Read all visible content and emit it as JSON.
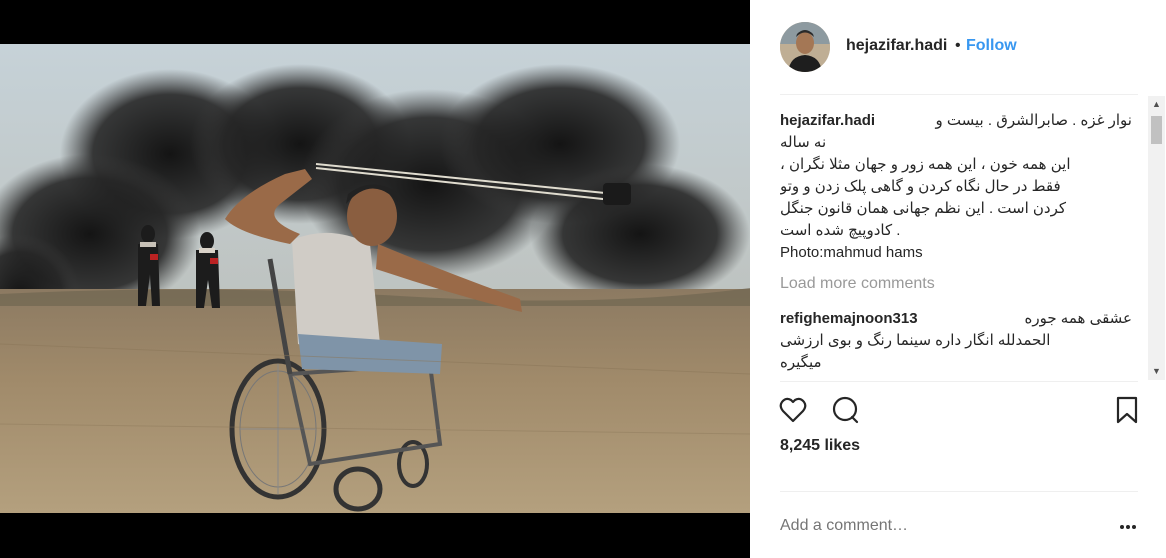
{
  "post": {
    "author": "hejazifar.hadi",
    "follow_label": "Follow",
    "dot": "•",
    "caption_author": "hejazifar.hadi",
    "caption_lines": [
      "نوار غزه . صابرالشرق . بیست و",
      "نه ساله",
      "این همه خون ، این همه زور و جهان مثلا نگران ،",
      "فقط در حال نگاه کردن و گاهی پلک زدن و وتو",
      "کردن است . این نظم جهانی همان قانون جنگل",
      ". کادوپیچ شده است",
      "Photo:mahmud hams"
    ],
    "load_more": "Load more comments",
    "comment": {
      "user": "refighemajnoon313",
      "lines": [
        "عشقی همه جوره",
        "الحمدلله انگار داره سینما رنگ و بوی ارزشی",
        "میگیره"
      ]
    },
    "likes": "8,245 likes",
    "add_comment_placeholder": "Add a comment…"
  },
  "icons": {
    "like": "heart-icon",
    "comment": "comment-bubble-icon",
    "save": "bookmark-icon",
    "more": "more-options-icon",
    "scroll_up": "scroll-up-arrow-icon",
    "scroll_down": "scroll-down-arrow-icon"
  },
  "colors": {
    "follow": "#3897f0",
    "muted": "#999999",
    "text": "#262626",
    "divider": "#efefef"
  }
}
